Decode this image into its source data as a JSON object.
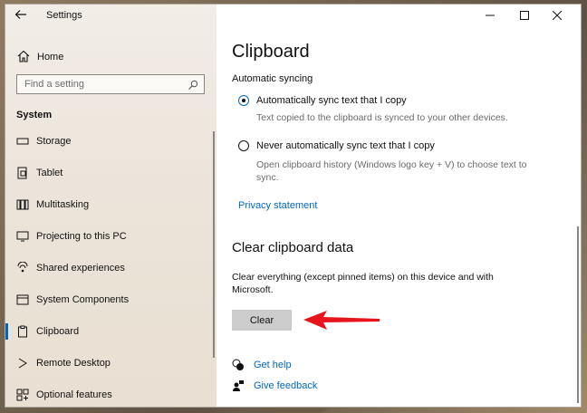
{
  "window": {
    "title": "Settings"
  },
  "sidebar": {
    "home_label": "Home",
    "search_placeholder": "Find a setting",
    "section_title": "System",
    "items": [
      {
        "label": "Storage"
      },
      {
        "label": "Tablet"
      },
      {
        "label": "Multitasking"
      },
      {
        "label": "Projecting to this PC"
      },
      {
        "label": "Shared experiences"
      },
      {
        "label": "System Components"
      },
      {
        "label": "Clipboard",
        "active": true
      },
      {
        "label": "Remote Desktop"
      },
      {
        "label": "Optional features"
      }
    ]
  },
  "main": {
    "title": "Clipboard",
    "sync_heading": "Automatic syncing",
    "option1_label": "Automatically sync text that I copy",
    "option1_desc": "Text copied to the clipboard is synced to your other devices.",
    "option2_label": "Never automatically sync text that I copy",
    "option2_desc": "Open clipboard history (Windows logo key + V) to choose text to sync.",
    "privacy_link": "Privacy statement",
    "clear_heading": "Clear clipboard data",
    "clear_desc": "Clear everything (except pinned items) on this device and with Microsoft.",
    "clear_button": "Clear",
    "get_help": "Get help",
    "give_feedback": "Give feedback"
  },
  "colors": {
    "accent": "#0067c0",
    "arrow": "#e8141b"
  }
}
